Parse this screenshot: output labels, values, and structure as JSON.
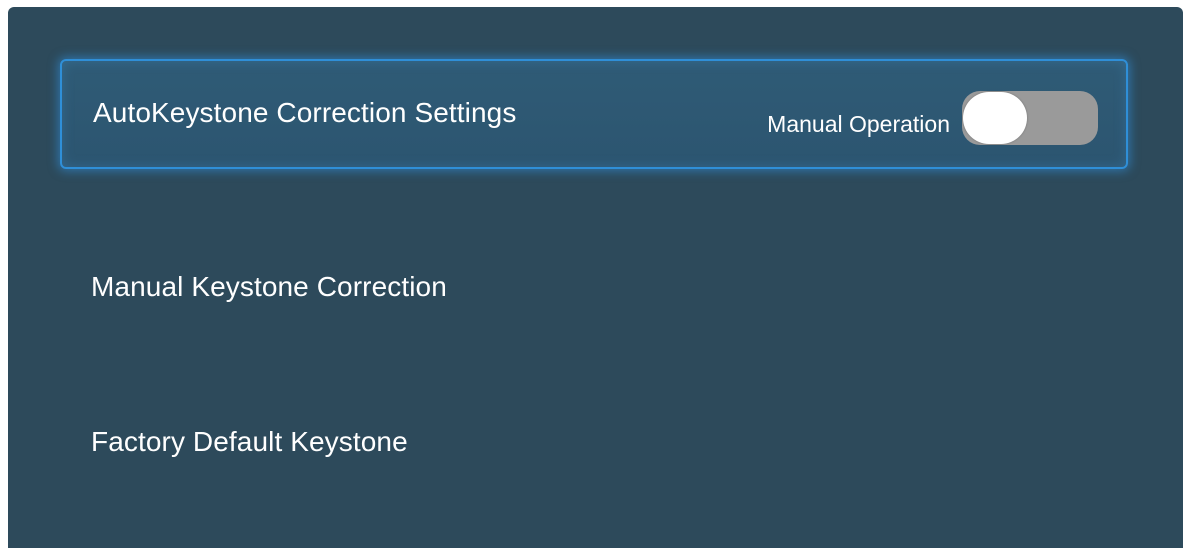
{
  "menu": {
    "items": [
      {
        "label": "AutoKeystone Correction Settings",
        "focused": true,
        "toggle": {
          "caption": "Manual Operation",
          "state": "off"
        }
      },
      {
        "label": "Manual Keystone Correction"
      },
      {
        "label": "Factory Default Keystone"
      }
    ]
  },
  "colors": {
    "panel_background": "#2d4a5b",
    "focus_border": "#2f8fd8",
    "toggle_track": "#9a9a9a",
    "toggle_knob": "#ffffff",
    "text": "#ffffff"
  }
}
